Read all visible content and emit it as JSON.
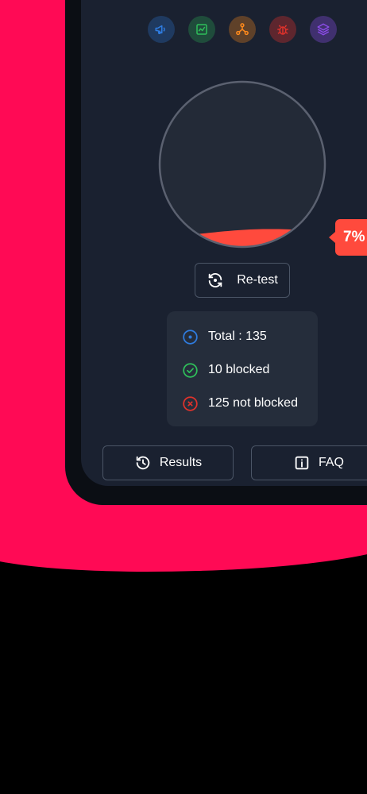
{
  "colors": {
    "background": "#000000",
    "pink": "#ff0a55",
    "screen": "#1a2130",
    "card": "#252d3b",
    "accent_red": "#ff4a3d",
    "blue": "#2f7ce0",
    "green": "#2fbf5a",
    "orange": "#ff8a1c",
    "red": "#e0322b",
    "purple": "#8a4ce6"
  },
  "categories": [
    {
      "icon": "megaphone-icon",
      "color": "#2f7ce0"
    },
    {
      "icon": "chart-icon",
      "color": "#2fbf5a"
    },
    {
      "icon": "network-icon",
      "color": "#ff8a1c"
    },
    {
      "icon": "bug-icon",
      "color": "#e0322b"
    },
    {
      "icon": "layers-icon",
      "color": "#8a4ce6"
    }
  ],
  "gauge": {
    "percent": 7,
    "percent_label": "7%"
  },
  "actions": {
    "retest_label": "Re-test",
    "results_label": "Results",
    "faq_label": "FAQ"
  },
  "stats": {
    "total": "Total : 135",
    "blocked": "10 blocked",
    "not_blocked": "125 not blocked"
  }
}
